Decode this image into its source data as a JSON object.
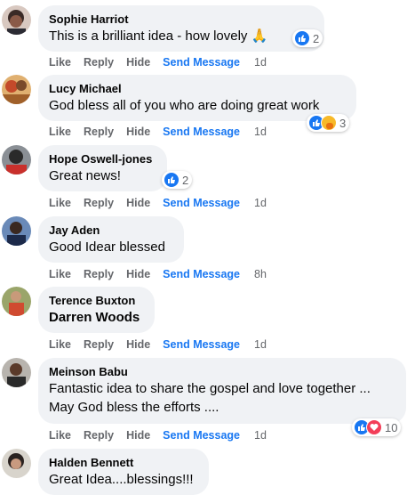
{
  "comments": [
    {
      "author": "Sophie Harriot",
      "text": "This is a brilliant idea - how lovely 🙏",
      "reactions": "2",
      "time": "1d"
    },
    {
      "author": "Lucy Michael",
      "text": "God bless all of you who are doing great work",
      "reactions": "3",
      "time": "1d"
    },
    {
      "author": "Hope Oswell-jones",
      "text": "Great news!",
      "reactions": "2",
      "time": "1d"
    },
    {
      "author": "Jay Aden",
      "text": "Good Idear blessed",
      "time": "8h"
    },
    {
      "author": "Terence Buxton",
      "text": "Darren Woods",
      "time": "1d"
    },
    {
      "author": "Meinson Babu",
      "text_line1": "Fantastic idea to share the gospel and love together ...",
      "text_line2": "May God bless the efforts ....",
      "reactions": "10",
      "time": "1d"
    },
    {
      "author": "Halden Bennett",
      "text": "Great Idea....blessings!!!"
    }
  ],
  "actions": {
    "like": "Like",
    "reply": "Reply",
    "hide": "Hide",
    "send": "Send Message"
  },
  "colors": {
    "link": "#1877f2",
    "muted": "#65676b",
    "bubble": "#f0f2f5"
  }
}
